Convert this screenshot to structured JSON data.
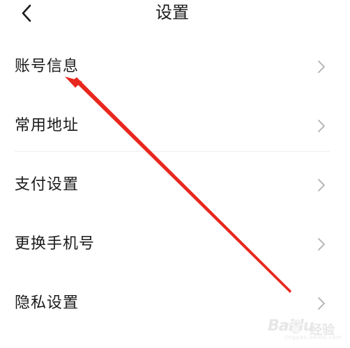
{
  "header": {
    "title": "设置",
    "back_icon": "chevron-left-icon"
  },
  "menu": {
    "items": [
      {
        "label": "账号信息",
        "icon": "chevron-right-icon"
      },
      {
        "label": "常用地址",
        "icon": "chevron-right-icon"
      },
      {
        "label": "支付设置",
        "icon": "chevron-right-icon"
      },
      {
        "label": "更换手机号",
        "icon": "chevron-right-icon"
      },
      {
        "label": "隐私设置",
        "icon": "chevron-right-icon"
      }
    ]
  },
  "annotation": {
    "arrow_color": "#e8281e"
  },
  "watermark": {
    "logo_text": "Baidu",
    "suffix": "经验",
    "sub_text": "jingyan.baidu.com"
  },
  "colors": {
    "text": "#1a1a1a",
    "chevron": "#b0b0b0",
    "divider": "#eeeeee",
    "background": "#ffffff"
  }
}
